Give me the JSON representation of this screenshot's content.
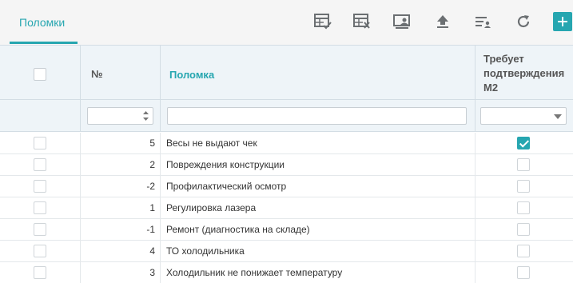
{
  "tabs": [
    {
      "label": "Поломки",
      "active": true
    }
  ],
  "toolbar": {
    "icons": [
      "table-check-icon",
      "table-delete-icon",
      "user-card-icon",
      "upload-icon",
      "filter-user-icon",
      "refresh-icon"
    ],
    "add_label": "+"
  },
  "grid": {
    "columns": {
      "number": "№",
      "fault": "Поломка",
      "requires_line1": "Требует",
      "requires_line2": "подтверждения",
      "requires_line3": "М2"
    },
    "filters": {
      "number": "",
      "fault": "",
      "requires": ""
    },
    "rows": [
      {
        "num": "5",
        "fault": "Весы не выдают чек",
        "requires": true
      },
      {
        "num": "2",
        "fault": "Повреждения конструкции",
        "requires": false
      },
      {
        "num": "-2",
        "fault": "Профилактический осмотр",
        "requires": false
      },
      {
        "num": "1",
        "fault": "Регулировка лазера",
        "requires": false
      },
      {
        "num": "-1",
        "fault": "Ремонт (диагностика на складе)",
        "requires": false
      },
      {
        "num": "4",
        "fault": "ТО холодильника",
        "requires": false
      },
      {
        "num": "3",
        "fault": "Холодильник не понижает температуру",
        "requires": false
      }
    ]
  },
  "colors": {
    "accent": "#26a6b0",
    "header_bg": "#eef4f8",
    "icon": "#6b6f72"
  }
}
